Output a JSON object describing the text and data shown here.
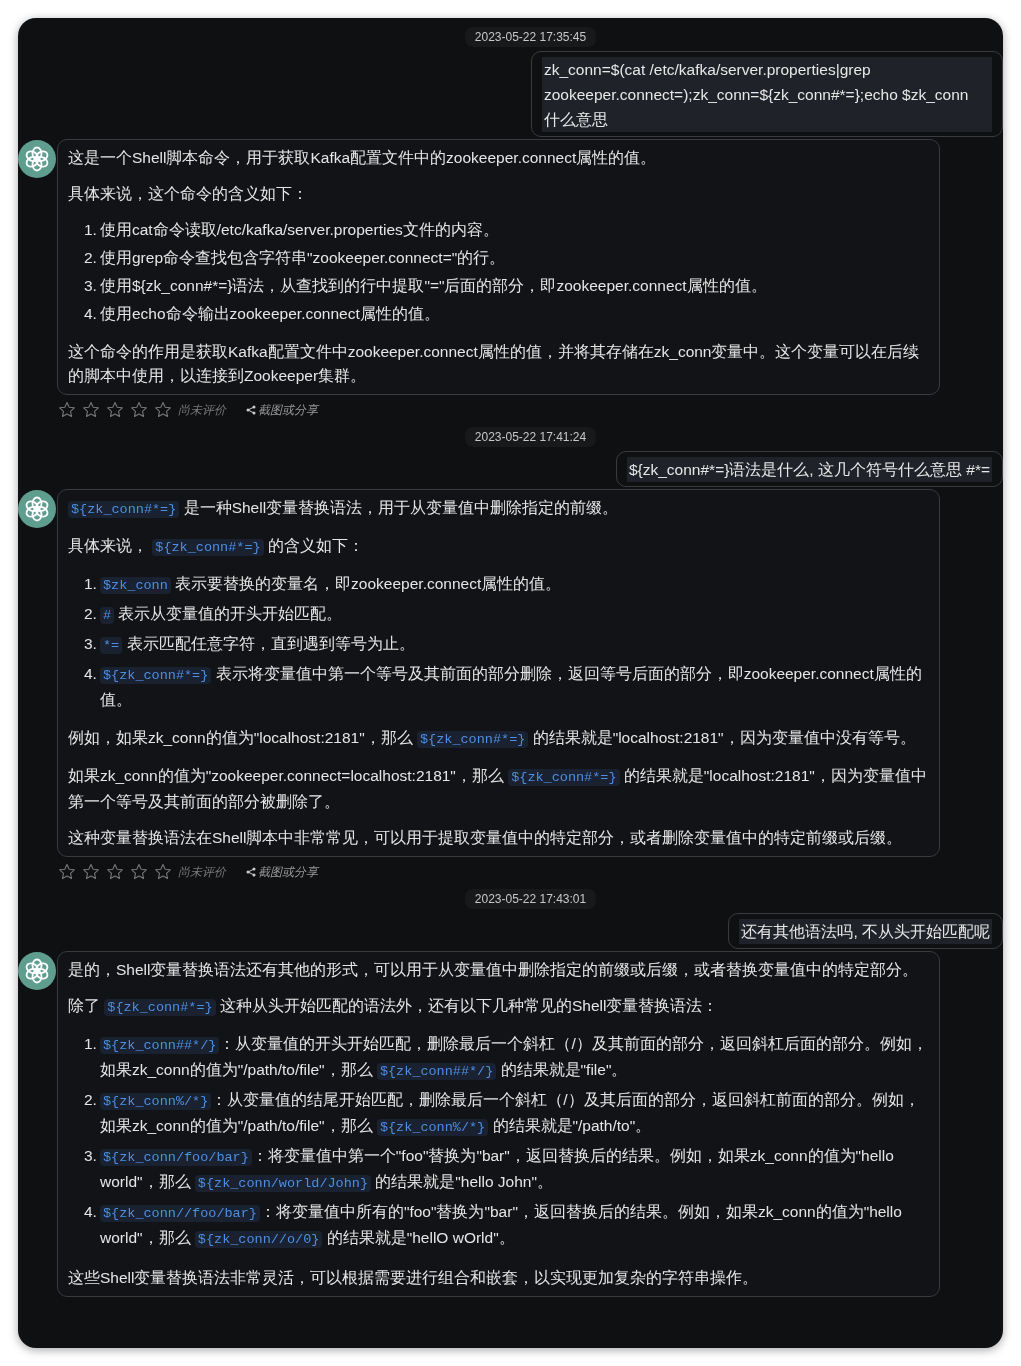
{
  "messages": [
    {
      "kind": "time",
      "text": "2023-05-22 17:35:45"
    },
    {
      "kind": "user",
      "text": "zk_conn=$(cat /etc/kafka/server.properties|grep zookeeper.connect=);zk_conn=${zk_conn#*=};echo $zk_conn\n什么意思"
    },
    {
      "kind": "assistant",
      "blocks": [
        {
          "kind": "paragraph",
          "segments": [
            {
              "kind": "text",
              "text": "这是一个Shell脚本命令，用于获取Kafka配置文件中的zookeeper.connect属性的值。"
            }
          ]
        },
        {
          "kind": "paragraph",
          "segments": [
            {
              "kind": "text",
              "text": "具体来说，这个命令的含义如下："
            }
          ]
        },
        {
          "kind": "list",
          "items": [
            {
              "number": "1.",
              "segments": [
                {
                  "kind": "text",
                  "text": "使用cat命令读取/etc/kafka/server.properties文件的内容。"
                }
              ]
            },
            {
              "number": "2.",
              "segments": [
                {
                  "kind": "text",
                  "text": "使用grep命令查找包含字符串\"zookeeper.connect=\"的行。"
                }
              ]
            },
            {
              "number": "3.",
              "segments": [
                {
                  "kind": "text",
                  "text": "使用${zk_conn#*=}语法，从查找到的行中提取\"=\"后面的部分，即zookeeper.connect属性的值。"
                }
              ]
            },
            {
              "number": "4.",
              "segments": [
                {
                  "kind": "text",
                  "text": "使用echo命令输出zookeeper.connect属性的值。"
                }
              ]
            }
          ]
        },
        {
          "kind": "paragraph",
          "segments": [
            {
              "kind": "text",
              "text": "这个命令的作用是获取Kafka配置文件中zookeeper.connect属性的值，并将其存储在zk_conn变量中。这个变量可以在后续的脚本中使用，以连接到Zookeeper集群。"
            }
          ]
        }
      ],
      "rating": {
        "stars": 0,
        "label": "尚未评价",
        "share": "截图或分享"
      }
    },
    {
      "kind": "time",
      "text": "2023-05-22 17:41:24"
    },
    {
      "kind": "user",
      "text": "${zk_conn#*=}语法是什么, 这几个符号什么意思 #*="
    },
    {
      "kind": "assistant",
      "blocks": [
        {
          "kind": "paragraph",
          "segments": [
            {
              "kind": "code",
              "text": "${zk_conn#*=}"
            },
            {
              "kind": "text",
              "text": " 是一种Shell变量替换语法，用于从变量值中删除指定的前缀。"
            }
          ]
        },
        {
          "kind": "paragraph",
          "segments": [
            {
              "kind": "text",
              "text": "具体来说， "
            },
            {
              "kind": "code",
              "text": "${zk_conn#*=}"
            },
            {
              "kind": "text",
              "text": " 的含义如下："
            }
          ]
        },
        {
          "kind": "list",
          "items": [
            {
              "number": "1.",
              "segments": [
                {
                  "kind": "code",
                  "text": "$zk_conn"
                },
                {
                  "kind": "text",
                  "text": " 表示要替换的变量名，即zookeeper.connect属性的值。"
                }
              ]
            },
            {
              "number": "2.",
              "segments": [
                {
                  "kind": "code",
                  "text": "#"
                },
                {
                  "kind": "text",
                  "text": " 表示从变量值的开头开始匹配。"
                }
              ]
            },
            {
              "number": "3.",
              "segments": [
                {
                  "kind": "code",
                  "text": "*="
                },
                {
                  "kind": "text",
                  "text": " 表示匹配任意字符，直到遇到等号为止。"
                }
              ]
            },
            {
              "number": "4.",
              "segments": [
                {
                  "kind": "code",
                  "text": "${zk_conn#*=}"
                },
                {
                  "kind": "text",
                  "text": " 表示将变量值中第一个等号及其前面的部分删除，返回等号后面的部分，即zookeeper.connect属性的值。"
                }
              ]
            }
          ]
        },
        {
          "kind": "paragraph",
          "segments": [
            {
              "kind": "text",
              "text": "例如，如果zk_conn的值为\"localhost:2181\"，那么 "
            },
            {
              "kind": "code",
              "text": "${zk_conn#*=}"
            },
            {
              "kind": "text",
              "text": " 的结果就是\"localhost:2181\"，因为变量值中没有等号。"
            }
          ]
        },
        {
          "kind": "paragraph",
          "segments": [
            {
              "kind": "text",
              "text": "如果zk_conn的值为\"zookeeper.connect=localhost:2181\"，那么 "
            },
            {
              "kind": "code",
              "text": "${zk_conn#*=}"
            },
            {
              "kind": "text",
              "text": " 的结果就是\"localhost:2181\"，因为变量值中第一个等号及其前面的部分被删除了。"
            }
          ]
        },
        {
          "kind": "paragraph",
          "segments": [
            {
              "kind": "text",
              "text": "这种变量替换语法在Shell脚本中非常常见，可以用于提取变量值中的特定部分，或者删除变量值中的特定前缀或后缀。"
            }
          ]
        }
      ],
      "rating": {
        "stars": 0,
        "label": "尚未评价",
        "share": "截图或分享"
      }
    },
    {
      "kind": "time",
      "text": "2023-05-22 17:43:01"
    },
    {
      "kind": "user",
      "text": "还有其他语法吗, 不从头开始匹配呢"
    },
    {
      "kind": "assistant",
      "blocks": [
        {
          "kind": "paragraph",
          "segments": [
            {
              "kind": "text",
              "text": "是的，Shell变量替换语法还有其他的形式，可以用于从变量值中删除指定的前缀或后缀，或者替换变量值中的特定部分。"
            }
          ]
        },
        {
          "kind": "paragraph",
          "segments": [
            {
              "kind": "text",
              "text": "除了 "
            },
            {
              "kind": "code",
              "text": "${zk_conn#*=}"
            },
            {
              "kind": "text",
              "text": " 这种从头开始匹配的语法外，还有以下几种常见的Shell变量替换语法："
            }
          ]
        },
        {
          "kind": "list",
          "items": [
            {
              "number": "1.",
              "segments": [
                {
                  "kind": "code",
                  "text": "${zk_conn##*/}"
                },
                {
                  "kind": "text",
                  "text": "：从变量值的开头开始匹配，删除最后一个斜杠（/）及其前面的部分，返回斜杠后面的部分。例如，如果zk_conn的值为\"/path/to/file\"，那么 "
                },
                {
                  "kind": "code",
                  "text": "${zk_conn##*/}"
                },
                {
                  "kind": "text",
                  "text": " 的结果就是\"file\"。"
                }
              ]
            },
            {
              "number": "2.",
              "segments": [
                {
                  "kind": "code",
                  "text": "${zk_conn%/*}"
                },
                {
                  "kind": "text",
                  "text": "：从变量值的结尾开始匹配，删除最后一个斜杠（/）及其后面的部分，返回斜杠前面的部分。例如，如果zk_conn的值为\"/path/to/file\"，那么 "
                },
                {
                  "kind": "code",
                  "text": "${zk_conn%/*}"
                },
                {
                  "kind": "text",
                  "text": " 的结果就是\"/path/to\"。"
                }
              ]
            },
            {
              "number": "3.",
              "segments": [
                {
                  "kind": "code",
                  "text": "${zk_conn/foo/bar}"
                },
                {
                  "kind": "text",
                  "text": "：将变量值中第一个\"foo\"替换为\"bar\"，返回替换后的结果。例如，如果zk_conn的值为\"hello world\"，那么 "
                },
                {
                  "kind": "code",
                  "text": "${zk_conn/world/John}"
                },
                {
                  "kind": "text",
                  "text": " 的结果就是\"hello John\"。"
                }
              ]
            },
            {
              "number": "4.",
              "segments": [
                {
                  "kind": "code",
                  "text": "${zk_conn//foo/bar}"
                },
                {
                  "kind": "text",
                  "text": "：将变量值中所有的\"foo\"替换为\"bar\"，返回替换后的结果。例如，如果zk_conn的值为\"hello world\"，那么 "
                },
                {
                  "kind": "code",
                  "text": "${zk_conn//o/0}"
                },
                {
                  "kind": "text",
                  "text": " 的结果就是\"hellO wOrld\"。"
                }
              ]
            }
          ]
        },
        {
          "kind": "paragraph",
          "segments": [
            {
              "kind": "text",
              "text": "这些Shell变量替换语法非常灵活，可以根据需要进行组合和嵌套，以实现更加复杂的字符串操作。"
            }
          ]
        }
      ]
    }
  ]
}
